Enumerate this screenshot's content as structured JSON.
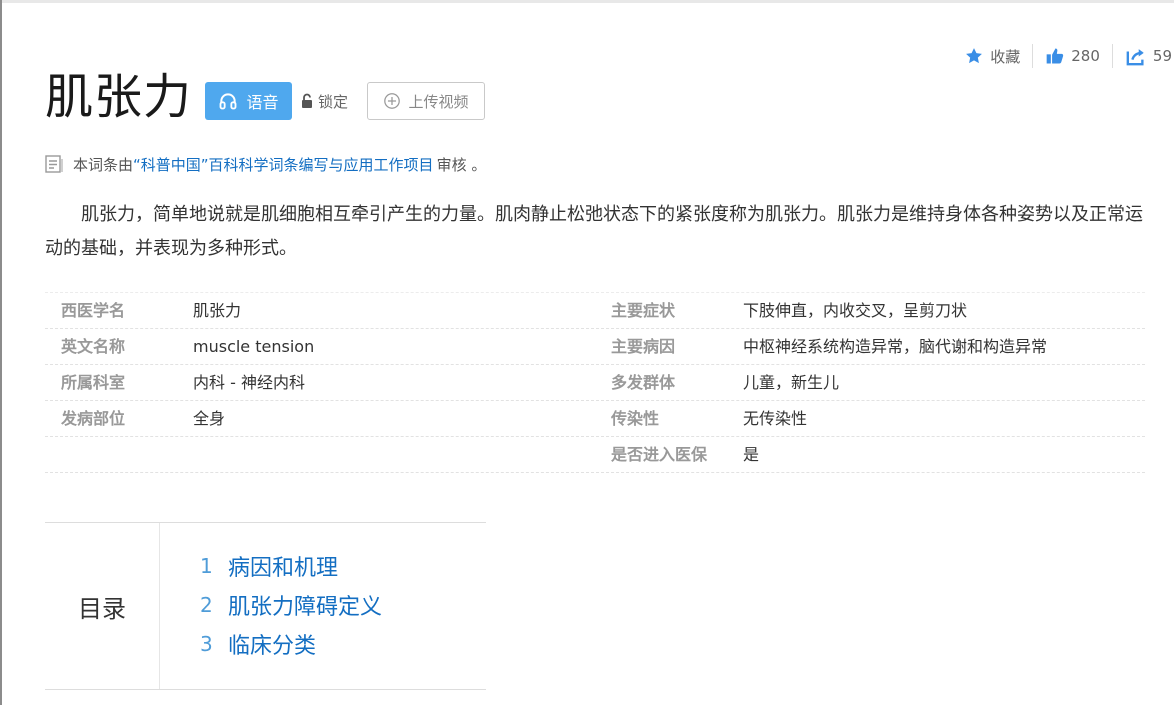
{
  "actions": {
    "favorite_label": "收藏",
    "like_count": "280",
    "share_count": "59"
  },
  "title": "肌张力",
  "toolbar": {
    "voice_label": "语音",
    "lock_label": "锁定",
    "upload_label": "上传视频"
  },
  "review_note": {
    "prefix": "本词条由",
    "link": "“科普中国”百科科学词条编写与应用工作项目",
    "suffix": "审核 。"
  },
  "summary": "肌张力，简单地说就是肌细胞相互牵引产生的力量。肌肉静止松弛状态下的紧张度称为肌张力。肌张力是维持身体各种姿势以及正常运动的基础，并表现为多种形式。",
  "basic_info": {
    "rows": [
      {
        "left_key": "西医学名",
        "left_value": "肌张力",
        "right_key": "主要症状",
        "right_value": "下肢伸直，内收交叉，呈剪刀状"
      },
      {
        "left_key": "英文名称",
        "left_value": "muscle tension",
        "right_key": "主要病因",
        "right_value": "中枢神经系统构造异常，脑代谢和构造异常"
      },
      {
        "left_key": "所属科室",
        "left_value": "内科 - 神经内科",
        "right_key": "多发群体",
        "right_value": "儿童，新生儿"
      },
      {
        "left_key": "发病部位",
        "left_value": "全身",
        "right_key": "传染性",
        "right_value": "无传染性"
      },
      {
        "left_key": "",
        "left_value": "",
        "right_key": "是否进入医保",
        "right_value": "是"
      }
    ]
  },
  "catalog": {
    "heading": "目录",
    "items": [
      {
        "num": "1",
        "label": "病因和机理"
      },
      {
        "num": "2",
        "label": "肌张力障碍定义"
      },
      {
        "num": "3",
        "label": "临床分类"
      }
    ]
  },
  "colors": {
    "accent_blue": "#4fa8ee",
    "link_blue": "#136ec2",
    "key_gray": "#999999"
  },
  "icons": [
    "star-icon",
    "thumbs-up-icon",
    "share-icon",
    "headphones-icon",
    "lock-icon",
    "plus-circle-icon",
    "document-icon"
  ]
}
